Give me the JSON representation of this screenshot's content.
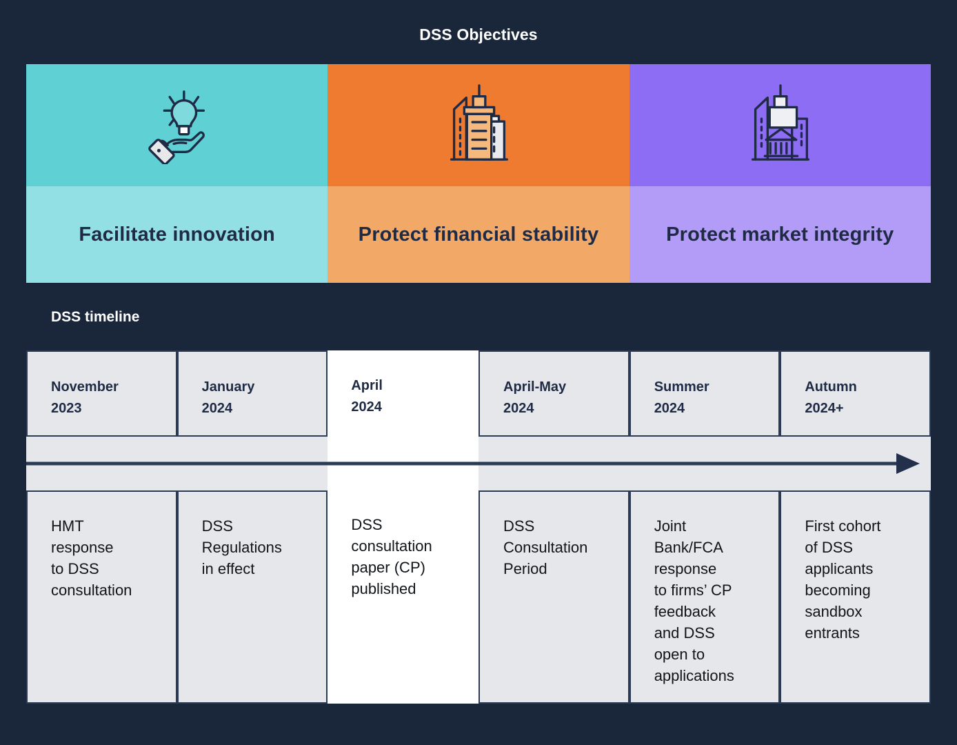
{
  "title": "DSS Objectives",
  "colors": {
    "background": "#1a2639",
    "ink": "#1f2a44",
    "teal_icon_band": "#5fd0d3",
    "teal_label_band": "#92e0e3",
    "orange_icon_band": "#ee7b2f",
    "orange_label_band": "#f2a866",
    "purple_icon_band": "#8e6df5",
    "purple_label_band": "#b39cf7",
    "cell_gray": "#e5e7eb",
    "cell_highlight": "#ffffff",
    "cell_border": "#2b3a55"
  },
  "objectives": [
    {
      "label": "Facilitate innovation",
      "icon": "lightbulb-in-hand-icon",
      "icon_band_color": "#5fd0d3",
      "label_band_color": "#92e0e3"
    },
    {
      "label": "Protect financial stability",
      "icon": "city-buildings-icon",
      "icon_band_color": "#ee7b2f",
      "label_band_color": "#f2a866"
    },
    {
      "label": "Protect market integrity",
      "icon": "classical-bank-building-icon",
      "icon_band_color": "#8e6df5",
      "label_band_color": "#b39cf7"
    }
  ],
  "timeline": {
    "heading": "DSS timeline",
    "arrow_direction": "left-to-right",
    "columns": [
      {
        "period": "November\n2023",
        "event": "HMT\nresponse\nto DSS\nconsultation",
        "highlighted": false
      },
      {
        "period": "January\n2024",
        "event": "DSS\nRegulations\nin effect",
        "highlighted": false
      },
      {
        "period": "April\n2024",
        "event": "DSS\nconsultation\npaper (CP)\npublished",
        "highlighted": true
      },
      {
        "period": "April-May\n2024",
        "event": "DSS\nConsultation\nPeriod",
        "highlighted": false
      },
      {
        "period": "Summer\n2024",
        "event": "Joint\nBank/FCA\nresponse\nto firms’ CP\nfeedback\nand DSS\nopen to\napplications",
        "highlighted": false
      },
      {
        "period": "Autumn\n2024+",
        "event": "First cohort\nof DSS\napplicants\nbecoming\nsandbox\nentrants",
        "highlighted": false
      }
    ]
  }
}
